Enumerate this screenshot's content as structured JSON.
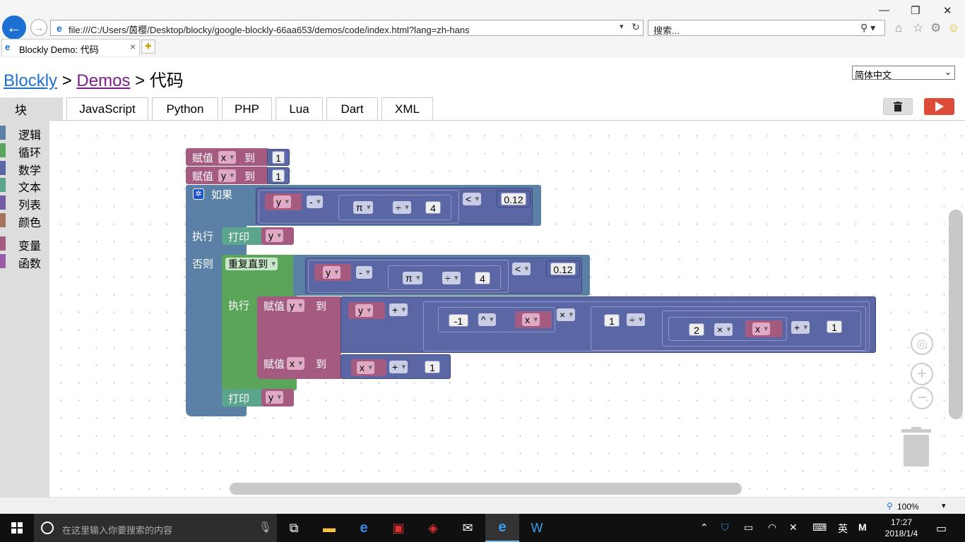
{
  "browser": {
    "address": "file:///C:/Users/茵樱/Desktop/blocky/google-blockly-66aa653/demos/code/index.html?lang=zh-hans",
    "search_placeholder": "搜索...",
    "tab_title": "Blockly Demo: 代码",
    "zoom_level": "100%"
  },
  "page": {
    "crumb_1": "Blockly",
    "crumb_2": "Demos",
    "crumb_sep": ">",
    "crumb_3": "代码",
    "language": "简体中文"
  },
  "code_tabs": {
    "blocks": "块",
    "items": [
      "JavaScript",
      "Python",
      "PHP",
      "Lua",
      "Dart",
      "XML"
    ]
  },
  "toolbox": {
    "categories": [
      {
        "label": "逻辑",
        "color": "#5b80a5"
      },
      {
        "label": "循环",
        "color": "#5ba55b"
      },
      {
        "label": "数学",
        "color": "#5b67a5"
      },
      {
        "label": "文本",
        "color": "#5ba58c"
      },
      {
        "label": "列表",
        "color": "#745ba5"
      },
      {
        "label": "颜色",
        "color": "#a5745b"
      },
      {
        "label": "变量",
        "color": "#a55b80"
      },
      {
        "label": "函数",
        "color": "#995ba5"
      }
    ]
  },
  "blocks": {
    "set": "赋值",
    "to": "到",
    "if": "如果",
    "do": "执行",
    "else": "否则",
    "print": "打印",
    "repeat_until": "重复直到",
    "var_x": "x",
    "var_y": "y",
    "pi": "π",
    "op_minus": "-",
    "op_div": "÷",
    "op_lt": "<",
    "op_plus": "+",
    "op_pow": "^",
    "op_mul": "×",
    "n1": "1",
    "n4": "4",
    "n012": "0.12",
    "nm1": "-1",
    "n2": "2"
  },
  "taskbar": {
    "search_placeholder": "在这里输入你要搜索的内容",
    "ime": "英",
    "ime_mode": "M",
    "time": "17:27",
    "date": "2018/1/4"
  }
}
